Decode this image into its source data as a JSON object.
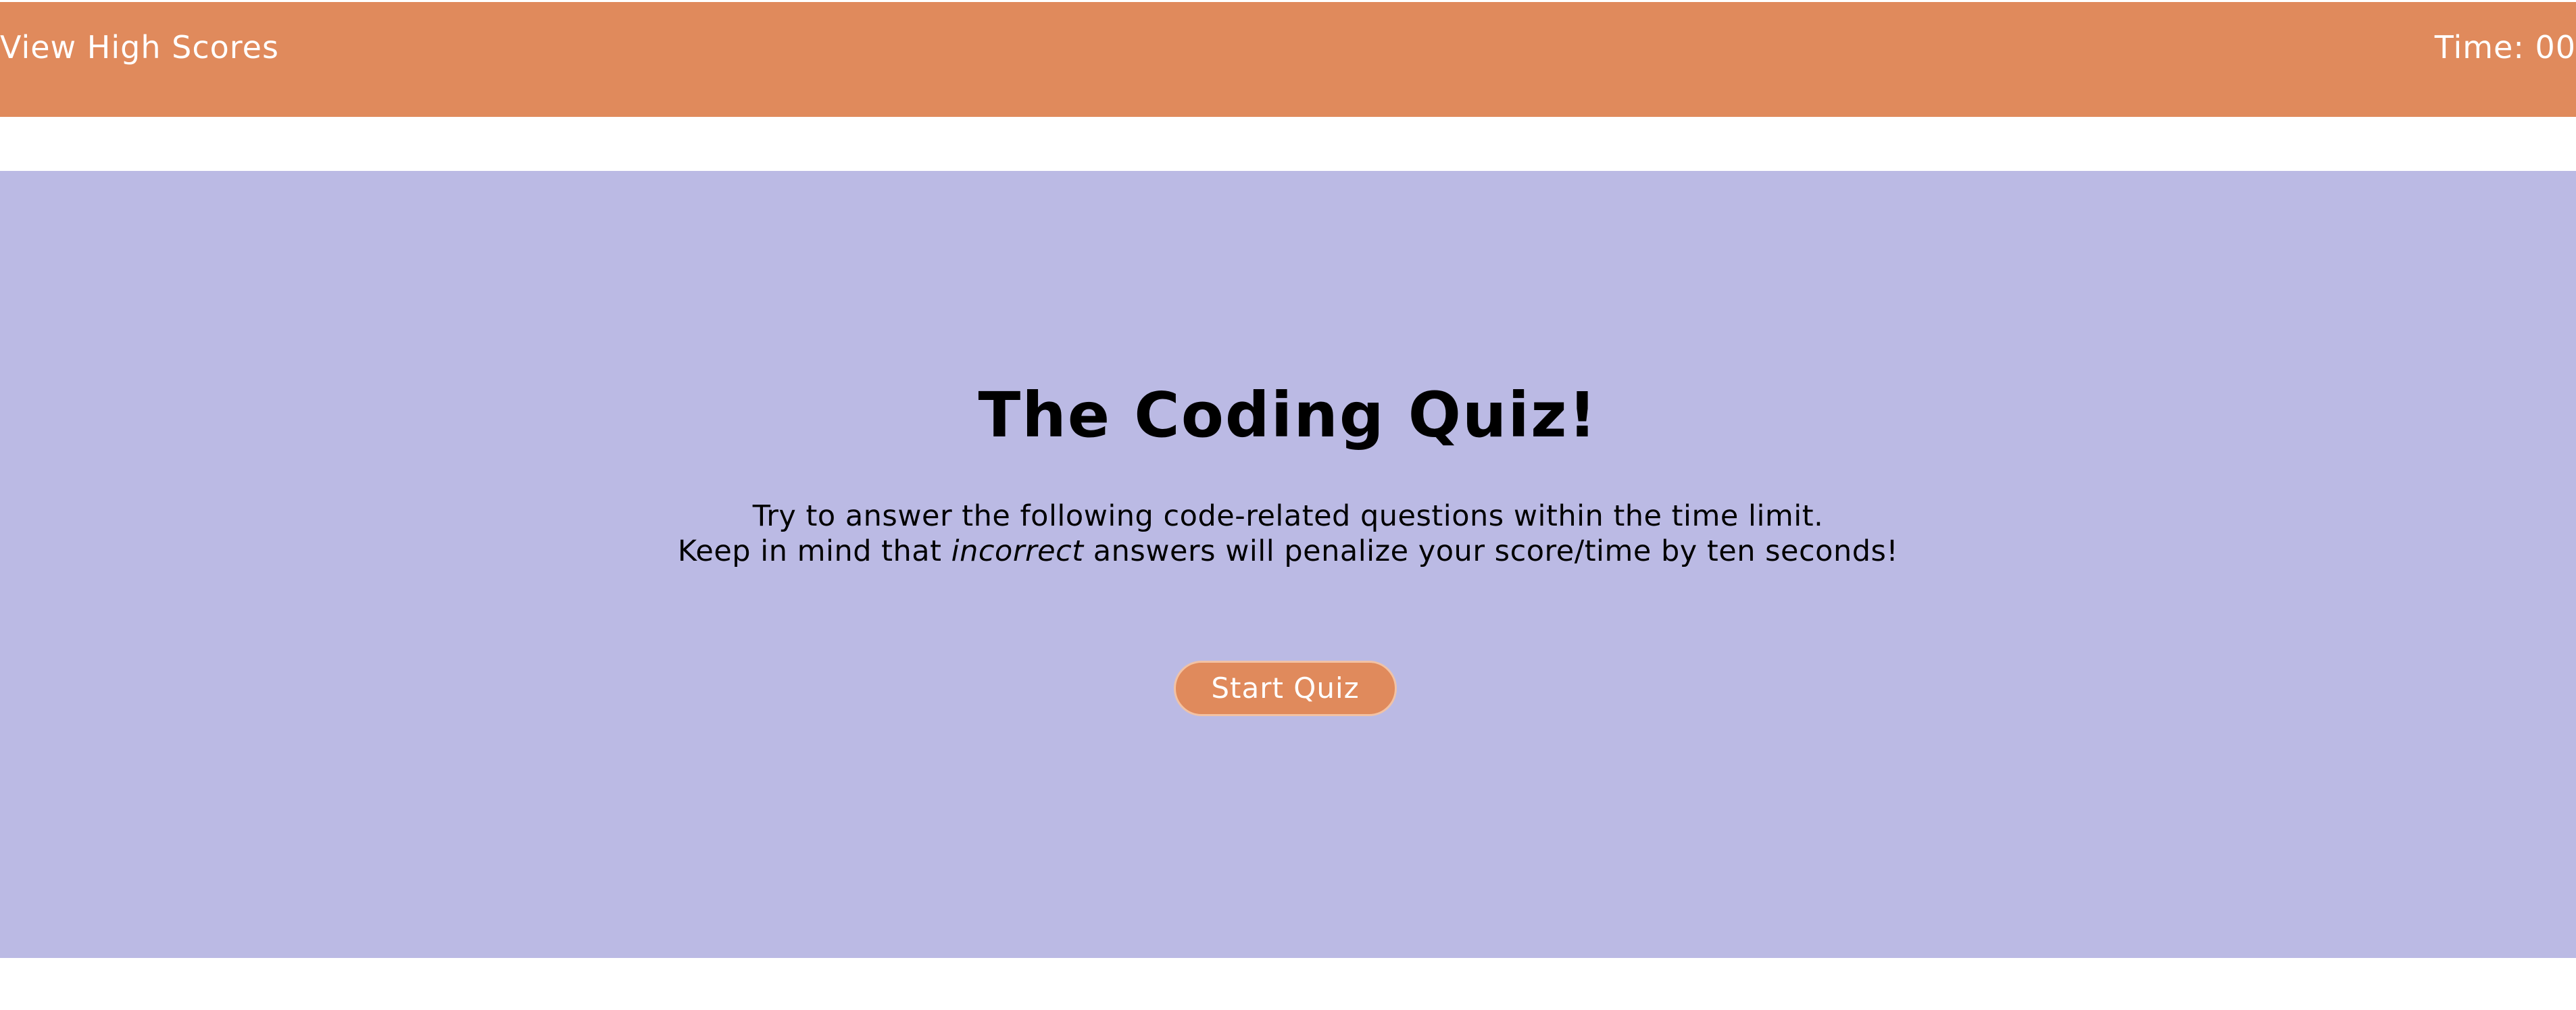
{
  "header": {
    "high_scores_link": "View High Scores",
    "timer_label": "Time: 00"
  },
  "main": {
    "title": "The Coding Quiz!",
    "intro_line1": "Try to answer the following code-related questions within the time limit.",
    "intro_line2_before": "Keep in mind that ",
    "intro_line2_emphasis": "incorrect",
    "intro_line2_after": " answers will penalize your score/time by ten seconds!",
    "start_button_label": "Start Quiz"
  },
  "colors": {
    "header_background": "#e08a5c",
    "main_background": "#bbbae4",
    "button_background": "#e08a5c",
    "button_border": "#f2c2a4",
    "text_light": "#ffffff",
    "text_dark": "#000000"
  }
}
